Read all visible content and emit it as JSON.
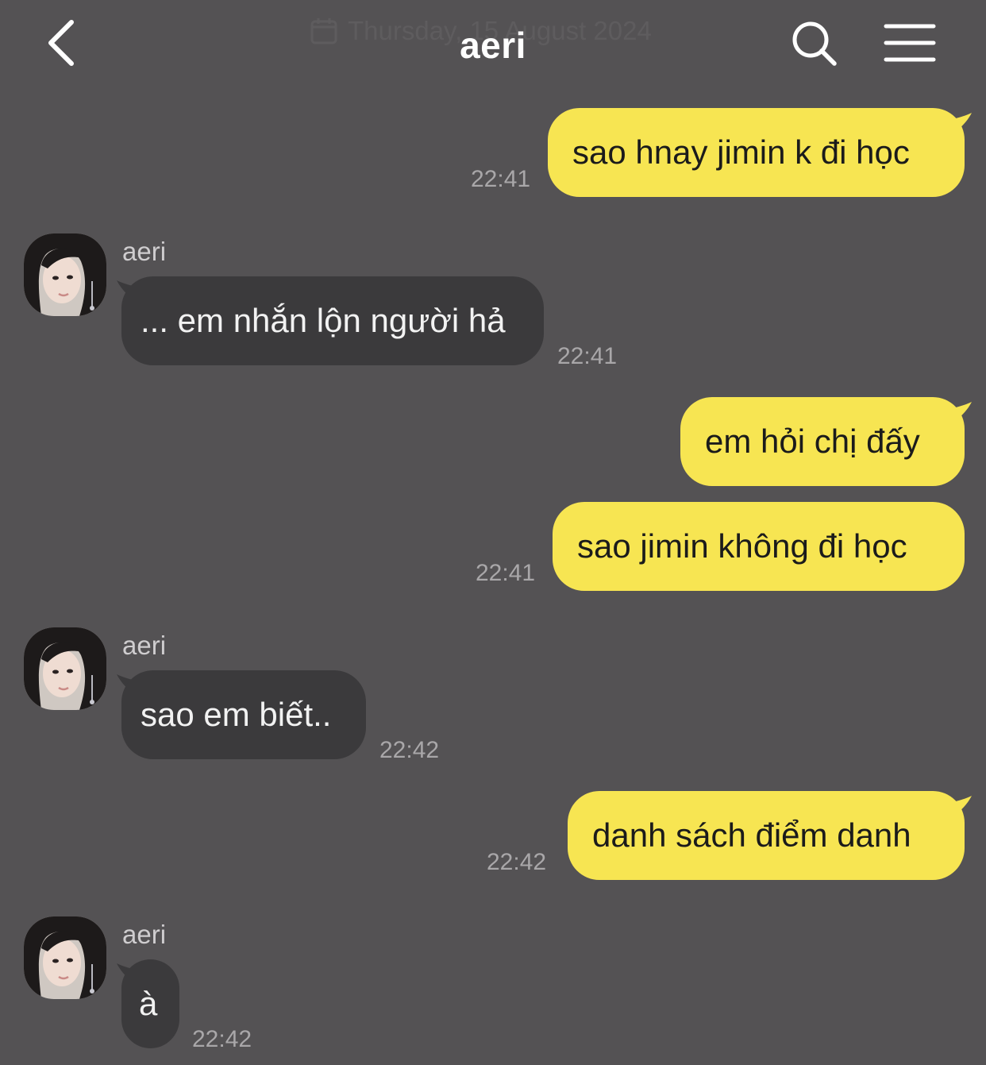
{
  "header": {
    "title": "aeri",
    "date_label": "Thursday, 15 August 2024"
  },
  "icons": {
    "back": "chevron-left-icon",
    "search": "search-icon",
    "menu": "hamburger-menu-icon",
    "calendar": "calendar-icon"
  },
  "colors": {
    "background": "#545254",
    "outgoing_bubble": "#f7e552",
    "incoming_bubble": "#3b3a3c"
  },
  "messages": [
    {
      "direction": "out",
      "text": "sao hnay jimin k đi học",
      "time": "22:41"
    },
    {
      "direction": "in",
      "sender": "aeri",
      "text": "... em nhắn lộn người hả",
      "time": "22:41"
    },
    {
      "direction": "out",
      "text": "em hỏi chị đấy"
    },
    {
      "direction": "out",
      "text": "sao jimin không đi học",
      "time": "22:41"
    },
    {
      "direction": "in",
      "sender": "aeri",
      "text": "sao em biết..",
      "time": "22:42"
    },
    {
      "direction": "out",
      "text": "danh sách điểm danh",
      "time": "22:42"
    },
    {
      "direction": "in",
      "sender": "aeri",
      "text": "à",
      "time": "22:42"
    }
  ]
}
